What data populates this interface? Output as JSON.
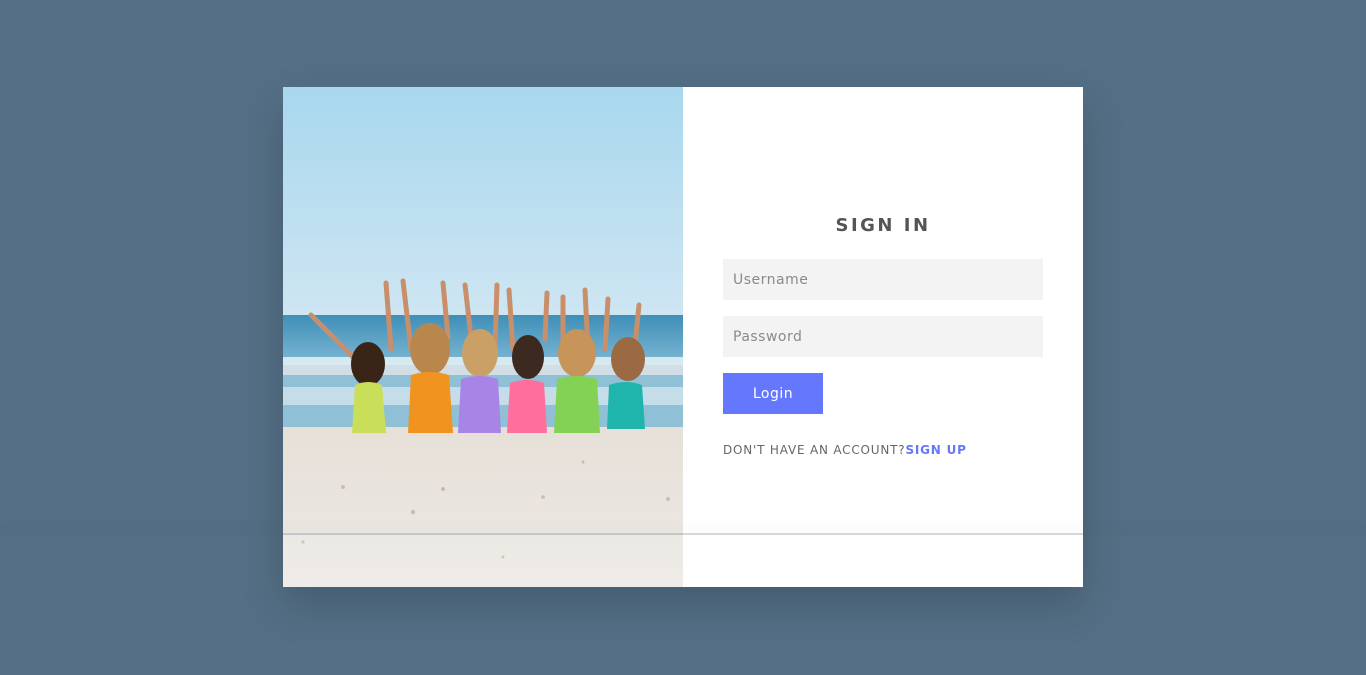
{
  "login": {
    "title": "SIGN IN",
    "username_placeholder": "Username",
    "password_placeholder": "Password",
    "button_label": "Login",
    "no_account_text": "DON'T HAVE AN ACCOUNT?",
    "signup_label": "SIGN UP"
  },
  "colors": {
    "background": "#546f86",
    "accent": "#6577fc",
    "input_bg": "#f3f3f3"
  },
  "image": {
    "subject": "beach-photo"
  }
}
